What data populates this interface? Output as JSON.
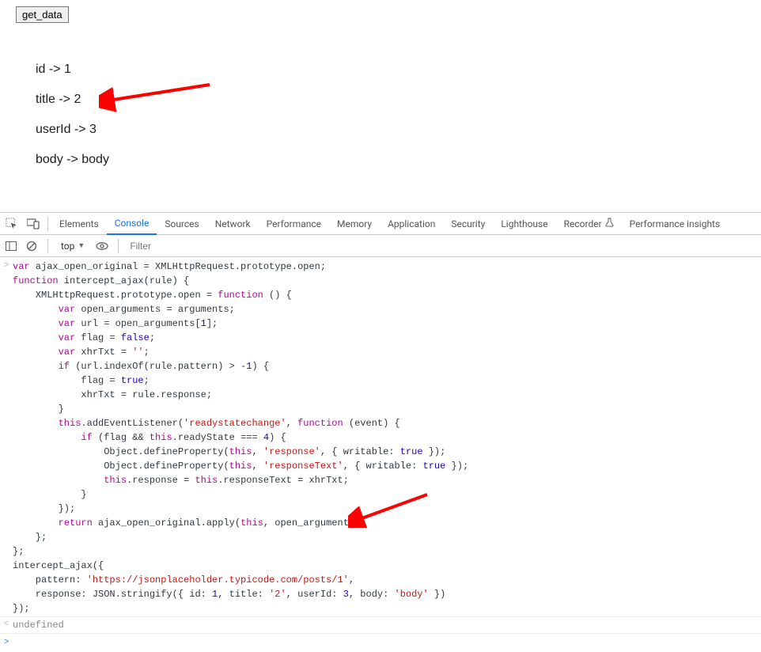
{
  "page": {
    "button_label": "get_data",
    "output_lines": [
      "id -> 1",
      "title -> 2",
      "userId -> 3",
      "body -> body"
    ]
  },
  "devtools": {
    "tabs": [
      "Elements",
      "Console",
      "Sources",
      "Network",
      "Performance",
      "Memory",
      "Application",
      "Security",
      "Lighthouse",
      "Recorder",
      "Performance insights"
    ],
    "active_tab": "Console",
    "toolbar": {
      "context": "top",
      "filter_placeholder": "Filter"
    },
    "console": {
      "input_gutter": ">",
      "result_gutter": "<",
      "prompt_gutter": ">",
      "input_lines": [
        [
          {
            "t": "kw",
            "v": "var"
          },
          {
            "t": "d",
            "v": " ajax_open_original = XMLHttpRequest.prototype.open;"
          }
        ],
        [
          {
            "t": "kw",
            "v": "function"
          },
          {
            "t": "d",
            "v": " intercept_ajax(rule) {"
          }
        ],
        [
          {
            "t": "d",
            "v": "    XMLHttpRequest.prototype.open = "
          },
          {
            "t": "kw",
            "v": "function"
          },
          {
            "t": "d",
            "v": " () {"
          }
        ],
        [
          {
            "t": "d",
            "v": "        "
          },
          {
            "t": "kw",
            "v": "var"
          },
          {
            "t": "d",
            "v": " open_arguments = arguments;"
          }
        ],
        [
          {
            "t": "d",
            "v": "        "
          },
          {
            "t": "kw",
            "v": "var"
          },
          {
            "t": "d",
            "v": " url = open_arguments["
          },
          {
            "t": "num",
            "v": "1"
          },
          {
            "t": "d",
            "v": "];"
          }
        ],
        [
          {
            "t": "d",
            "v": "        "
          },
          {
            "t": "kw",
            "v": "var"
          },
          {
            "t": "d",
            "v": " flag = "
          },
          {
            "t": "bool",
            "v": "false"
          },
          {
            "t": "d",
            "v": ";"
          }
        ],
        [
          {
            "t": "d",
            "v": "        "
          },
          {
            "t": "kw",
            "v": "var"
          },
          {
            "t": "d",
            "v": " xhrTxt = "
          },
          {
            "t": "str",
            "v": "''"
          },
          {
            "t": "d",
            "v": ";"
          }
        ],
        [
          {
            "t": "d",
            "v": "        "
          },
          {
            "t": "kw",
            "v": "if"
          },
          {
            "t": "d",
            "v": " (url.indexOf(rule.pattern) > -"
          },
          {
            "t": "num",
            "v": "1"
          },
          {
            "t": "d",
            "v": ") {"
          }
        ],
        [
          {
            "t": "d",
            "v": "            flag = "
          },
          {
            "t": "bool",
            "v": "true"
          },
          {
            "t": "d",
            "v": ";"
          }
        ],
        [
          {
            "t": "d",
            "v": "            xhrTxt = rule.response;"
          }
        ],
        [
          {
            "t": "d",
            "v": "        }"
          }
        ],
        [
          {
            "t": "d",
            "v": "        "
          },
          {
            "t": "kw",
            "v": "this"
          },
          {
            "t": "d",
            "v": ".addEventListener("
          },
          {
            "t": "str",
            "v": "'readystatechange'"
          },
          {
            "t": "d",
            "v": ", "
          },
          {
            "t": "kw",
            "v": "function"
          },
          {
            "t": "d",
            "v": " (event) {"
          }
        ],
        [
          {
            "t": "d",
            "v": "            "
          },
          {
            "t": "kw",
            "v": "if"
          },
          {
            "t": "d",
            "v": " (flag && "
          },
          {
            "t": "kw",
            "v": "this"
          },
          {
            "t": "d",
            "v": ".readyState === "
          },
          {
            "t": "num",
            "v": "4"
          },
          {
            "t": "d",
            "v": ") {"
          }
        ],
        [
          {
            "t": "d",
            "v": "                Object.defineProperty("
          },
          {
            "t": "kw",
            "v": "this"
          },
          {
            "t": "d",
            "v": ", "
          },
          {
            "t": "str",
            "v": "'response'"
          },
          {
            "t": "d",
            "v": ", { writable: "
          },
          {
            "t": "bool",
            "v": "true"
          },
          {
            "t": "d",
            "v": " });"
          }
        ],
        [
          {
            "t": "d",
            "v": "                Object.defineProperty("
          },
          {
            "t": "kw",
            "v": "this"
          },
          {
            "t": "d",
            "v": ", "
          },
          {
            "t": "str",
            "v": "'responseText'"
          },
          {
            "t": "d",
            "v": ", { writable: "
          },
          {
            "t": "bool",
            "v": "true"
          },
          {
            "t": "d",
            "v": " });"
          }
        ],
        [
          {
            "t": "d",
            "v": "                "
          },
          {
            "t": "kw",
            "v": "this"
          },
          {
            "t": "d",
            "v": ".response = "
          },
          {
            "t": "kw",
            "v": "this"
          },
          {
            "t": "d",
            "v": ".responseText = xhrTxt;"
          }
        ],
        [
          {
            "t": "d",
            "v": "            }"
          }
        ],
        [
          {
            "t": "d",
            "v": "        });"
          }
        ],
        [
          {
            "t": "d",
            "v": "        "
          },
          {
            "t": "kw",
            "v": "return"
          },
          {
            "t": "d",
            "v": " ajax_open_original.apply("
          },
          {
            "t": "kw",
            "v": "this"
          },
          {
            "t": "d",
            "v": ", open_arguments);"
          }
        ],
        [
          {
            "t": "d",
            "v": "    };"
          }
        ],
        [
          {
            "t": "d",
            "v": "};"
          }
        ],
        [
          {
            "t": "d",
            "v": "intercept_ajax({"
          }
        ],
        [
          {
            "t": "d",
            "v": "    pattern: "
          },
          {
            "t": "str",
            "v": "'https://jsonplaceholder.typicode.com/posts/1'"
          },
          {
            "t": "d",
            "v": ","
          }
        ],
        [
          {
            "t": "d",
            "v": "    response: JSON.stringify({ id: "
          },
          {
            "t": "num",
            "v": "1"
          },
          {
            "t": "d",
            "v": ", title: "
          },
          {
            "t": "str",
            "v": "'2'"
          },
          {
            "t": "d",
            "v": ", userId: "
          },
          {
            "t": "num",
            "v": "3"
          },
          {
            "t": "d",
            "v": ", body: "
          },
          {
            "t": "str",
            "v": "'body'"
          },
          {
            "t": "d",
            "v": " })"
          }
        ],
        [
          {
            "t": "d",
            "v": "});"
          }
        ]
      ],
      "result_text": "undefined"
    }
  }
}
